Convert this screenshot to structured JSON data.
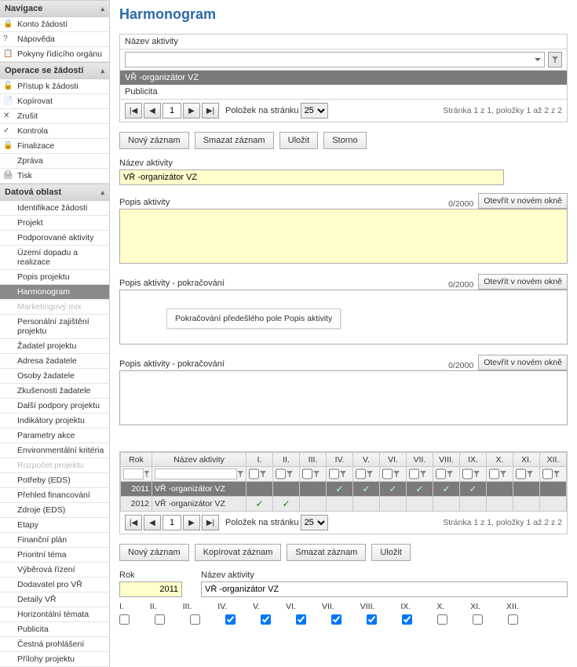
{
  "nav": {
    "sections": [
      {
        "header": "Navigace",
        "items": [
          {
            "icon": "🔒",
            "label": "Konto žádostí"
          },
          {
            "icon": "?",
            "label": "Nápověda"
          },
          {
            "icon": "📋",
            "label": "Pokyny řídícího orgánu"
          }
        ]
      },
      {
        "header": "Operace se žádostí",
        "items": [
          {
            "icon": "🔓",
            "label": "Přístup k žádosti"
          },
          {
            "icon": "📄",
            "label": "Kopírovat"
          },
          {
            "icon": "✕",
            "label": "Zrušit"
          },
          {
            "icon": "✓",
            "label": "Kontrola"
          },
          {
            "icon": "🔒",
            "label": "Finalizace"
          },
          {
            "icon": "",
            "label": "Zpráva"
          },
          {
            "icon": "🖨",
            "label": "Tisk"
          }
        ]
      },
      {
        "header": "Datová oblast",
        "items": [
          {
            "label": "Identifikace žádosti"
          },
          {
            "label": "Projekt"
          },
          {
            "label": "Podporované aktivity"
          },
          {
            "label": "Území dopadu a realizace"
          },
          {
            "label": "Popis projektu"
          },
          {
            "label": "Harmonogram",
            "selected": true
          },
          {
            "label": "Marketingový mix",
            "disabled": true
          },
          {
            "label": "Personální zajištění projektu"
          },
          {
            "label": "Žadatel projektu"
          },
          {
            "label": "Adresa žadatele"
          },
          {
            "label": "Osoby žadatele"
          },
          {
            "label": "Zkušenosti žadatele"
          },
          {
            "label": "Další podpory projektu"
          },
          {
            "label": "Indikátory projektu"
          },
          {
            "label": "Parametry akce"
          },
          {
            "label": "Environmentální kritéria"
          },
          {
            "label": "Rozpočet projektu",
            "disabled": true
          },
          {
            "label": "Potřeby (EDS)"
          },
          {
            "label": "Přehled financování"
          },
          {
            "label": "Zdroje (EDS)"
          },
          {
            "label": "Etapy"
          },
          {
            "label": "Finanční plán"
          },
          {
            "label": "Prioritní téma"
          },
          {
            "label": "Výběrová řízení"
          },
          {
            "label": "Dodavatel pro VŘ"
          },
          {
            "label": "Detaily VŘ"
          },
          {
            "label": "Horizontální témata"
          },
          {
            "label": "Publicita"
          },
          {
            "label": "Čestná prohlášení"
          },
          {
            "label": "Přílohy projektu"
          }
        ]
      }
    ]
  },
  "page": {
    "title": "Harmonogram",
    "activityLabel": "Název aktivity",
    "subheader1": "VŘ -organizátor VZ",
    "subheader2": "Publicita",
    "pager": {
      "first": "|◀",
      "prev": "◀",
      "page": "1",
      "next": "▶",
      "last": "▶|",
      "perPageLabel": "Položek na stránku",
      "perPage": "25",
      "info": "Stránka 1 z 1, položky 1 až 2 z 2"
    },
    "buttons": {
      "novy": "Nový záznam",
      "smazat": "Smazat záznam",
      "ulozit": "Uložit",
      "storno": "Storno",
      "kopirovat": "Kopírovat záznam",
      "otevrit": "Otevřít v novém okně"
    },
    "activityValue": "VŘ -organizátor VZ",
    "descLabel": "Popis aktivity",
    "descCont": "Popis aktivity - pokračování",
    "counter": "0/2000",
    "tooltip": "Pokračování předešlého pole Popis aktivity",
    "gridHeaders": [
      "Rok",
      "Název aktivity",
      "I.",
      "II.",
      "III.",
      "IV.",
      "V.",
      "VI.",
      "VII.",
      "VIII.",
      "IX.",
      "X.",
      "XI.",
      "XII."
    ],
    "gridRows": [
      {
        "rok": "2011",
        "nazev": "VŘ -organizátor VZ",
        "checks": [
          false,
          false,
          false,
          true,
          true,
          true,
          true,
          true,
          true,
          false,
          false,
          false
        ]
      },
      {
        "rok": "2012",
        "nazev": "VŘ -organizátor VZ",
        "checks": [
          true,
          true,
          false,
          false,
          false,
          false,
          false,
          false,
          false,
          false,
          false,
          false
        ]
      }
    ],
    "rokLabel": "Rok",
    "rokValue": "2011",
    "months": [
      "I.",
      "II.",
      "III.",
      "IV.",
      "V.",
      "VI.",
      "VII.",
      "VIII.",
      "IX.",
      "X.",
      "XI.",
      "XII."
    ],
    "monthChecks": [
      false,
      false,
      false,
      true,
      true,
      true,
      true,
      true,
      true,
      false,
      false,
      false
    ]
  }
}
